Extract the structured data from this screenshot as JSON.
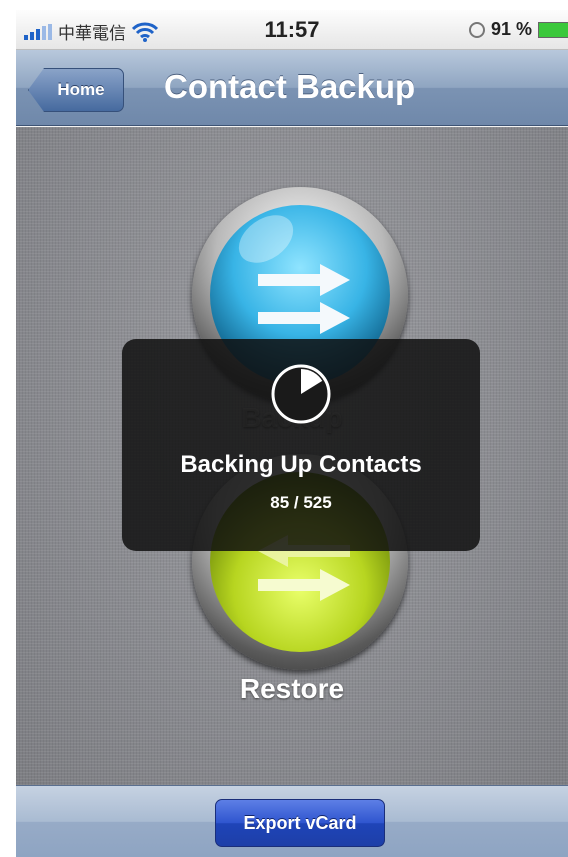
{
  "status_bar": {
    "carrier": "中華電信",
    "time": "11:57",
    "battery": "91 %",
    "icons": [
      "signal-icon",
      "wifi-icon",
      "lock-icon",
      "battery-icon"
    ]
  },
  "nav": {
    "back_label": "Home",
    "title": "Contact Backup"
  },
  "buttons": {
    "backup_label": "Backup",
    "restore_label": "Restore",
    "backup_color": "#38b4e6",
    "restore_color": "#b7d520"
  },
  "hud": {
    "title": "Backing Up Contacts",
    "count": "85 / 525",
    "progress": 0.162
  },
  "toolbar": {
    "export_label": "Export vCard",
    "accent": "#2f55cf"
  }
}
